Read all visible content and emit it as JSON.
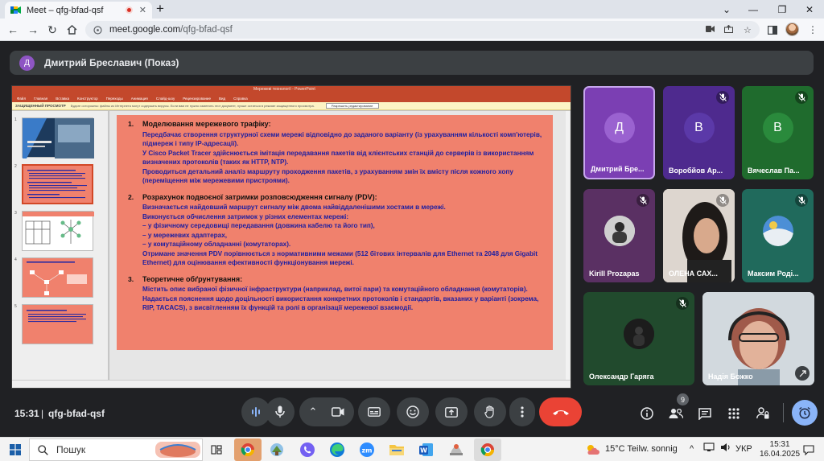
{
  "browser": {
    "tab_title": "Meet – qfg-bfad-qsf",
    "tab_close": "✕",
    "new_tab": "+",
    "url_host": "meet.google.com",
    "url_path": "/qfg-bfad-qsf",
    "window_controls": {
      "minimize": "—",
      "maximize": "❐",
      "close": "✕"
    }
  },
  "meet": {
    "presenter_initial": "Д",
    "presenter_label": "Дмитрий Бреславич (Показ)",
    "time": "15:31",
    "meeting_code": "qfg-bfad-qsf",
    "participants_count": "9",
    "participants": [
      {
        "name": "Дмитрий Бре...",
        "initial": "Д",
        "bg": "#7b3fb3",
        "avatar": "#9a62d0",
        "muted": false
      },
      {
        "name": "Воробйов Ар...",
        "initial": "В",
        "bg": "#4e2a8e",
        "avatar": "#5b39a8",
        "muted": true
      },
      {
        "name": "Вячеслав Па...",
        "initial": "В",
        "bg": "#1f6b2d",
        "avatar": "#2a8a3c",
        "muted": true
      },
      {
        "name": "Kirill Prozapas",
        "initial": "",
        "bg": "#5a3063",
        "avatar": "#777",
        "muted": true
      },
      {
        "name": "ОЛЕНА САХ...",
        "initial": "",
        "bg": "#d9d3cc",
        "avatar": "#777",
        "muted": true
      },
      {
        "name": "Максим Роді...",
        "initial": "",
        "bg": "#206a5c",
        "avatar": "#777",
        "muted": true
      },
      {
        "name": "Олександр Гаряга",
        "initial": "",
        "bg": "#214a2d",
        "avatar": "#333",
        "muted": true
      },
      {
        "name": "Надія Божко",
        "initial": "",
        "bg": "#cfd6dc",
        "avatar": "#777",
        "muted": false
      }
    ]
  },
  "powerpoint": {
    "title": "Мережеві технології - PowerPoint",
    "menu": [
      "Файл",
      "Главная",
      "Вставка",
      "Конструктор",
      "Переходы",
      "Анимация",
      "Слайд-шоу",
      "Рецензирование",
      "Вид",
      "Справка"
    ],
    "warning_title": "ЗАЩИЩЕННЫЙ ПРОСМОТР",
    "warning_text": "Будьте осторожны: файлы из Интернета могут содержать вирусы. Если вам не нужно изменять этот документ, лучше остаться в режиме защищенного просмотра.",
    "warning_button": "Разрешить редактирование",
    "slide_numbers": [
      "1",
      "2",
      "3",
      "4",
      "5"
    ],
    "slide": {
      "sections": [
        {
          "num": "1.",
          "heading": "Моделювання мережевого трафіку:",
          "lines": [
            "Передбачає створення структурної схеми мережі відповідно до заданого варіанту (із урахуванням кількості комп'ютерів, підмереж і типу IP-адресації).",
            "У Cisco Packet Tracer здійснюється імітація передавання пакетів від клієнтських станцій до серверів із використанням визначених протоколів (таких як HTTP, NTP).",
            "Проводиться детальний аналіз маршруту проходження пакетів, з урахуванням змін їх вмісту після кожного хопу (переміщення між мережевими пристроями)."
          ]
        },
        {
          "num": "2.",
          "heading": "Розрахунок подвоєної затримки розповсюдження сигналу (PDV):",
          "lines": [
            "Визначається найдовший маршрут сигналу між двома найвіддаленішими хостами в мережі.",
            "Виконується обчислення затримок у різних елементах мережі:",
            "– у фізичному середовищі передавання (довжина кабелю та його тип),",
            "– у мережевих адаптерах,",
            "– у комутаційному обладнанні (комутаторах).",
            "Отримане значення PDV порівнюється з нормативними межами (512 бітових інтервалів для Ethernet та 2048 для Gigabit Ethernet) для оцінювання ефективності функціонування мережі."
          ]
        },
        {
          "num": "3.",
          "heading": "Теоретичне обґрунтування:",
          "lines": [
            "Містить опис вибраної фізичної інфраструктури (наприклад, витої пари) та комутаційного обладнання (комутаторів).",
            "Надається пояснення щодо доцільності використання конкретних протоколів і стандартів, вказаних у варіанті (зокрема, RIP, TACACS), з висвітленням їх функцій та ролі в організації мережевої взаємодії."
          ]
        }
      ]
    }
  },
  "taskbar": {
    "search_label": "Пошук",
    "weather": "15°C  Teilw. sonnig",
    "language": "УКР",
    "clock_time": "15:31",
    "clock_date": "16.04.2025"
  },
  "colors": {
    "meet_bg": "#202124",
    "end_call": "#ea4335",
    "slide_bg": "#f0816d",
    "slide_text": "#2020a0",
    "ppt_accent": "#c3482c"
  }
}
